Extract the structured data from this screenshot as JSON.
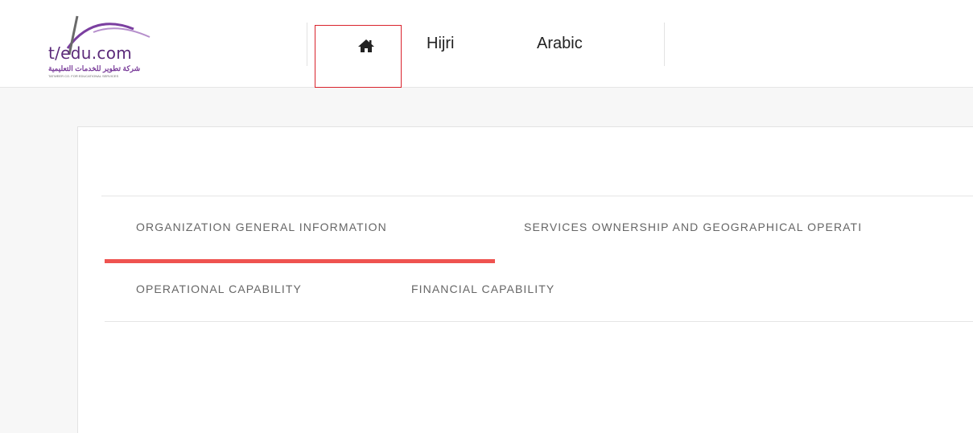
{
  "logo": {
    "main_text": "t/edu.com",
    "arabic_text": "شركة تطوير للخدمات التعليمية",
    "english_text": "TATWEER CO. FOR EDUCATIONAL SERVICES"
  },
  "nav": {
    "home_icon": "home-icon",
    "hijri_label": "Hijri",
    "arabic_label": "Arabic"
  },
  "tabs": [
    {
      "label": "ORGANIZATION GENERAL INFORMATION",
      "active": true
    },
    {
      "label": "SERVICES OWNERSHIP AND GEOGRAPHICAL OPERATI",
      "active": false
    },
    {
      "label": "OPERATIONAL CAPABILITY",
      "active": false
    },
    {
      "label": "FINANCIAL CAPABILITY",
      "active": false
    }
  ],
  "colors": {
    "accent": "#ef5350",
    "highlight_box": "#d9232d",
    "brand_purple": "#5b2a7a"
  }
}
